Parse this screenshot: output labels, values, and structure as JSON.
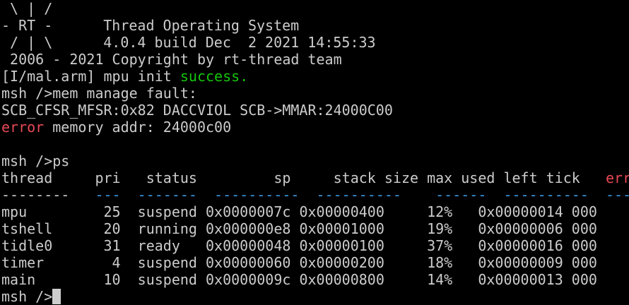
{
  "banner": {
    "line1": " \\ | /",
    "line2_prefix": "- RT -",
    "line2_title": "Thread Operating System",
    "line3_prefix": " / | \\",
    "line3_version": "4.0.4 build Dec  2 2021 14:55:33",
    "line4": " 2006 - 2021 Copyright by rt-thread team"
  },
  "log": {
    "mpu_prefix": "[I/mal.arm] mpu init ",
    "mpu_status": "success.",
    "fault_cmd": "msh />mem manage fault:",
    "fault_regs": "SCB_CFSR_MFSR:0x82 DACCVIOL SCB->MMAR:24000C00",
    "error_word": "error",
    "error_rest": " memory addr: 24000c00"
  },
  "ps": {
    "command": "msh />ps",
    "headers": {
      "thread": "thread",
      "pri": "pri",
      "status": "status",
      "sp": "sp",
      "stack_size": "stack size",
      "max_used": "max used",
      "left_tick": "left tick",
      "error": "error"
    },
    "separators": {
      "thread": "--------",
      "pri": "---",
      "status": "-------",
      "sp": "----------",
      "stack_size": "----------",
      "max_used": "------",
      "left_tick": "----------",
      "error": "---"
    },
    "rows": [
      {
        "thread": "mpu",
        "pri": "25",
        "status": "suspend",
        "sp": "0x0000007c",
        "stack_size": "0x00000400",
        "max_used": "12%",
        "left_tick": "0x00000014",
        "error": "000"
      },
      {
        "thread": "tshell",
        "pri": "20",
        "status": "running",
        "sp": "0x000000e8",
        "stack_size": "0x00001000",
        "max_used": "19%",
        "left_tick": "0x00000006",
        "error": "000"
      },
      {
        "thread": "tidle0",
        "pri": "31",
        "status": "ready",
        "sp": "0x00000048",
        "stack_size": "0x00000100",
        "max_used": "37%",
        "left_tick": "0x00000016",
        "error": "000"
      },
      {
        "thread": "timer",
        "pri": "4",
        "status": "suspend",
        "sp": "0x00000060",
        "stack_size": "0x00000200",
        "max_used": "18%",
        "left_tick": "0x00000009",
        "error": "000"
      },
      {
        "thread": "main",
        "pri": "10",
        "status": "suspend",
        "sp": "0x0000009c",
        "stack_size": "0x00000800",
        "max_used": "14%",
        "left_tick": "0x00000013",
        "error": "000"
      }
    ]
  },
  "prompt": "msh />",
  "colors": {
    "background": "#000000",
    "text": "#cccccc",
    "success": "#16c60c",
    "error": "#e74856",
    "separator": "#3a96dd"
  }
}
